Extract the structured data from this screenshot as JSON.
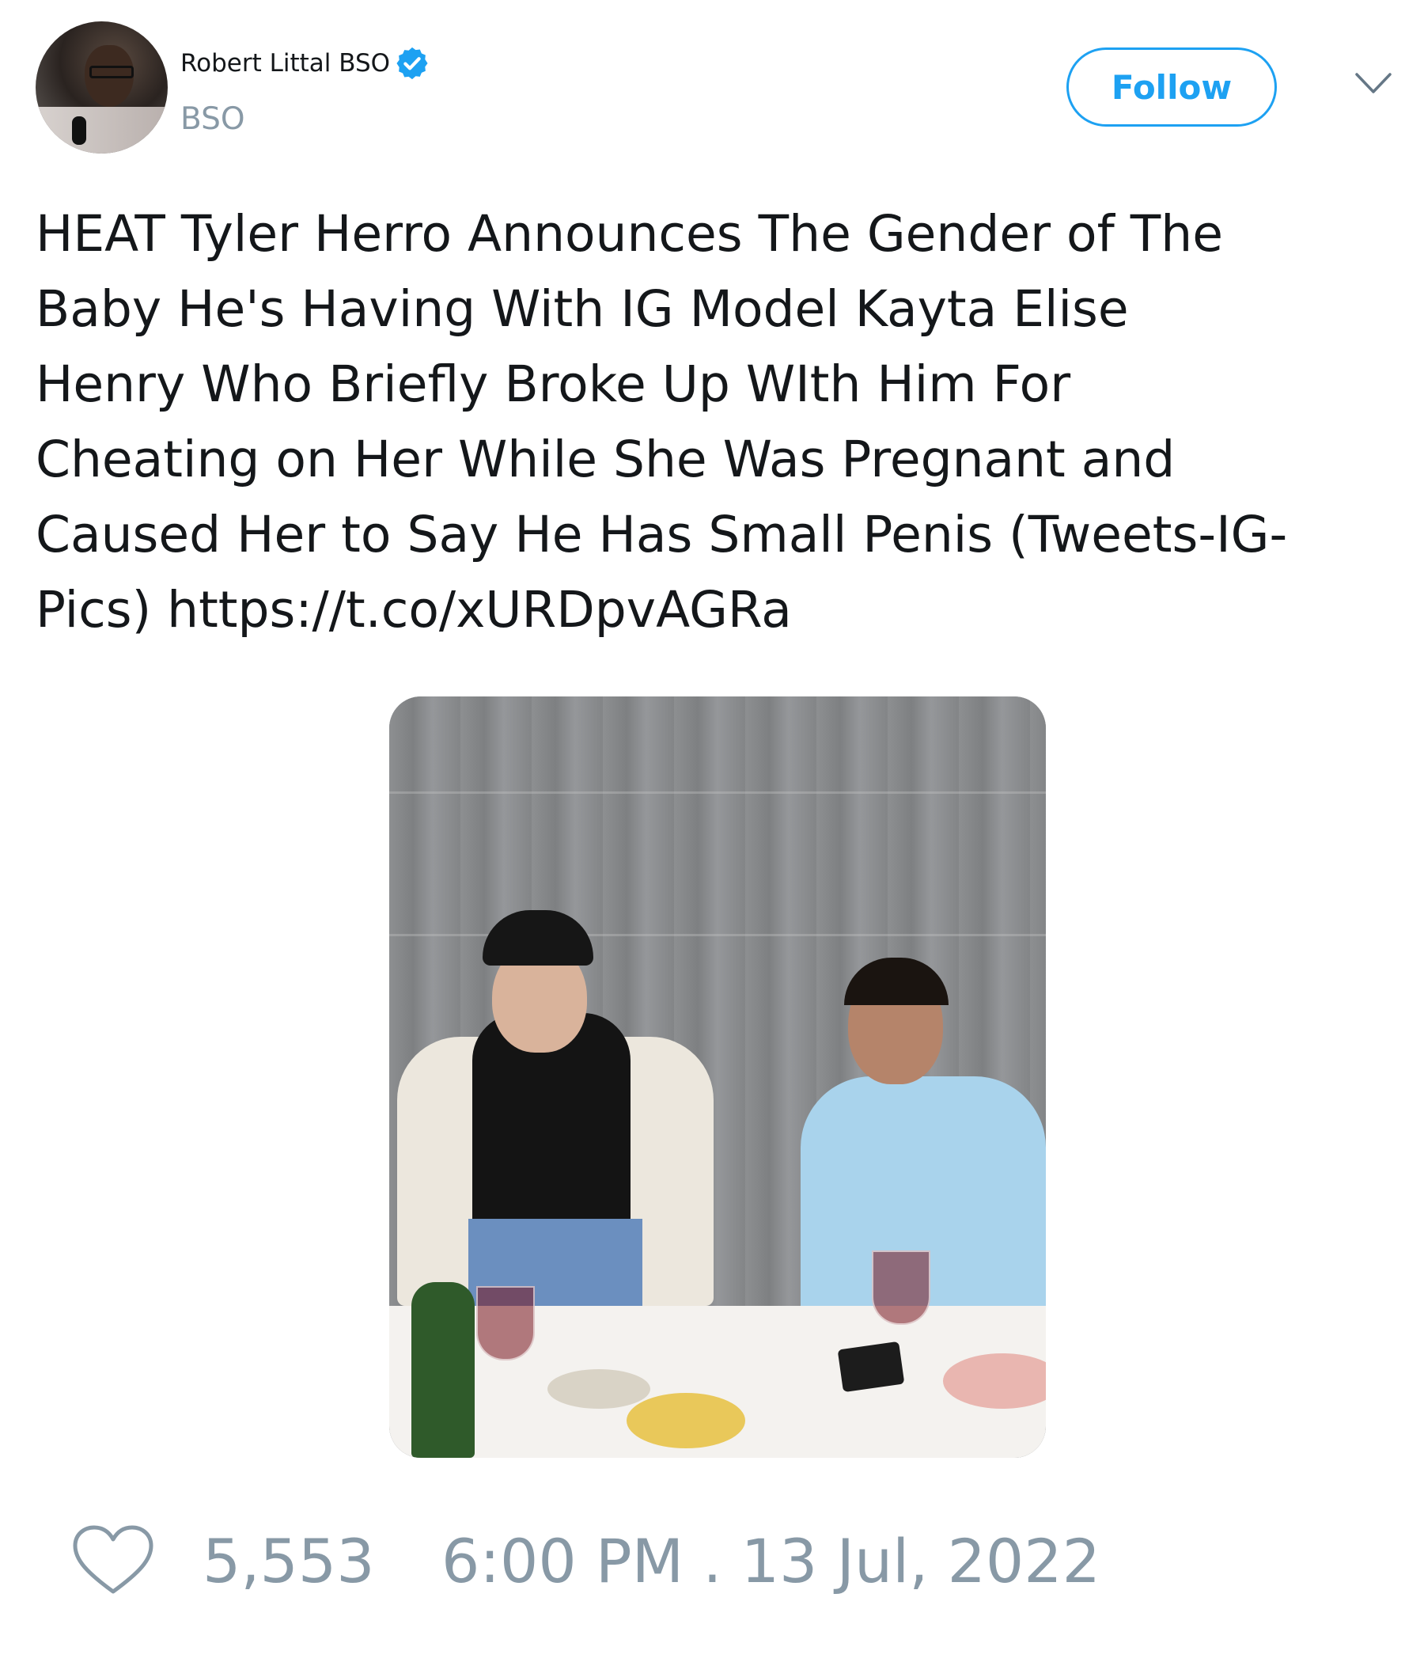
{
  "tweet": {
    "author": {
      "display_name": "Robert Littal BSO",
      "handle": "BSO",
      "verified": true
    },
    "follow_label": "Follow",
    "text_lines": [
      "HEAT Tyler Herro Announces The Gender of The",
      "Baby He's Having With IG Model Kayta Elise",
      "Henry Who Briefly Broke Up WIth Him For",
      "Cheating on Her While She Was Pregnant and",
      "Caused Her to Say He Has Small Penis (Tweets-IG-",
      "Pics) https://t.co/xURDpvAGRa"
    ],
    "likes": "5,553",
    "timestamp": "6:00 PM . 13 Jul, 2022"
  },
  "colors": {
    "accent": "#1da1f2",
    "muted": "#8899a6",
    "text": "#14171a"
  },
  "icons": [
    "verified-badge-icon",
    "chevron-down-icon",
    "heart-icon"
  ]
}
